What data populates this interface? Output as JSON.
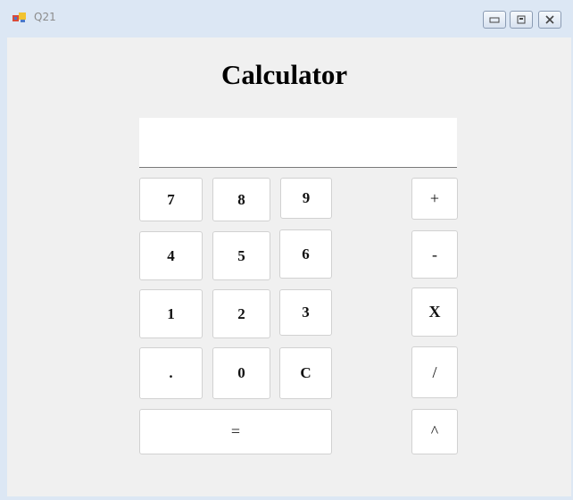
{
  "window": {
    "title": "Q21"
  },
  "heading": "Calculator",
  "display": {
    "value": ""
  },
  "keys": {
    "seven": "7",
    "eight": "8",
    "nine": "9",
    "four": "4",
    "five": "5",
    "six": "6",
    "one": "1",
    "two": "2",
    "three": "3",
    "dot": ".",
    "zero": "0",
    "clear": "C",
    "equals": "=",
    "plus": "+",
    "minus": "-",
    "multiply": "X",
    "divide": "/",
    "power": "^"
  }
}
